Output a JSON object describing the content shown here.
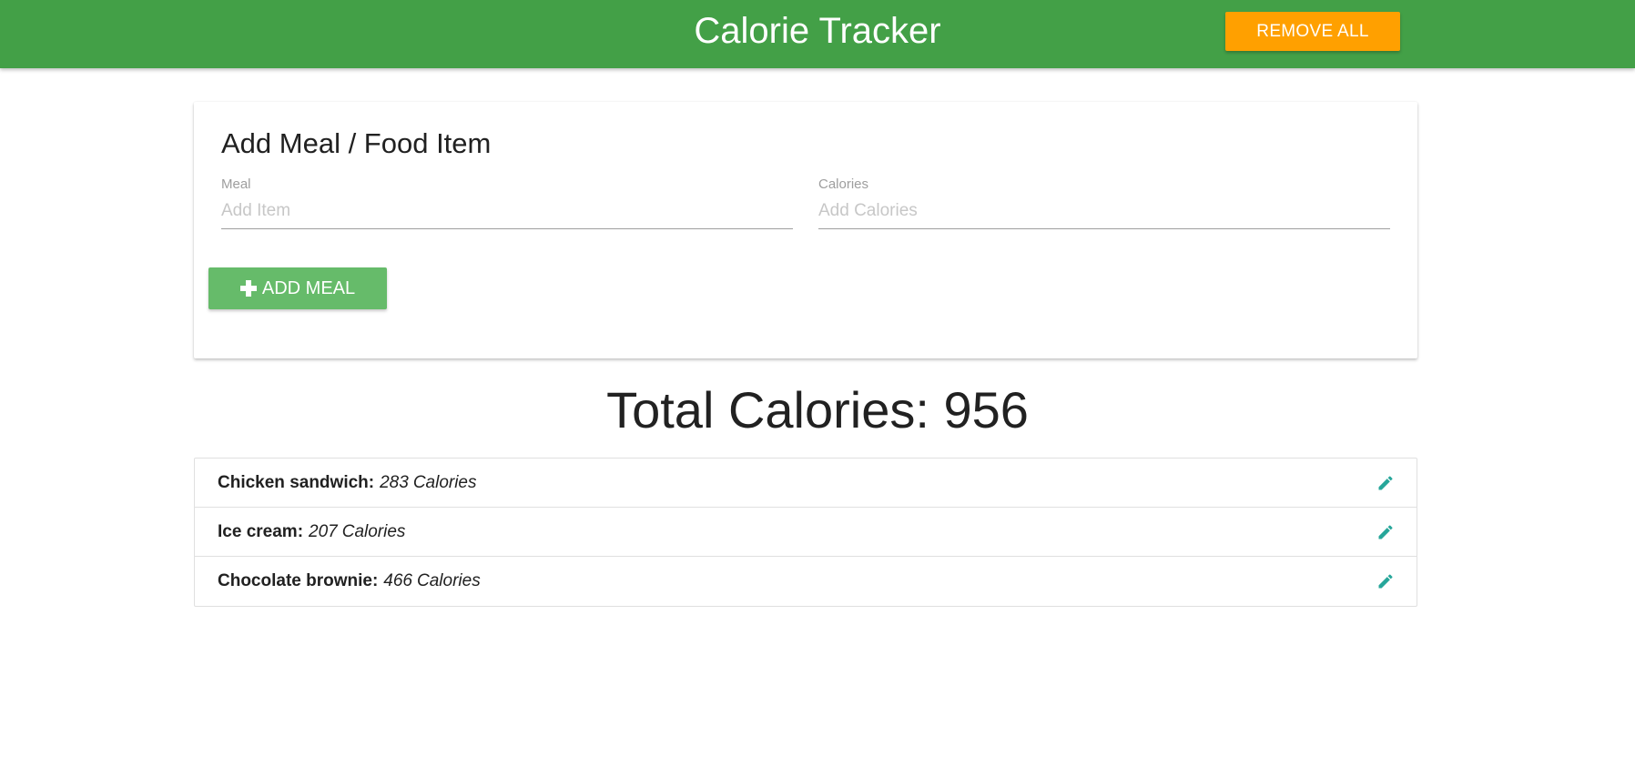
{
  "header": {
    "title": "Calorie Tracker",
    "remove_all_label": "REMOVE ALL"
  },
  "form": {
    "title": "Add Meal / Food Item",
    "meal_label": "Meal",
    "meal_placeholder": "Add Item",
    "meal_value": "",
    "calories_label": "Calories",
    "calories_placeholder": "Add Calories",
    "calories_value": "",
    "add_button_label": "ADD MEAL"
  },
  "total": {
    "text": "Total Calories: 956"
  },
  "items": [
    {
      "name": "Chicken sandwich",
      "calories": "283",
      "unit": "Calories"
    },
    {
      "name": "Ice cream",
      "calories": "207",
      "unit": "Calories"
    },
    {
      "name": "Chocolate brownie",
      "calories": "466",
      "unit": "Calories"
    }
  ],
  "colors": {
    "navbar": "#43a047",
    "remove_all": "#ffa000",
    "add_button": "#66bb6a",
    "edit_icon": "#26a69a"
  },
  "icons": {
    "add": "plus-icon",
    "edit": "pencil-icon"
  }
}
